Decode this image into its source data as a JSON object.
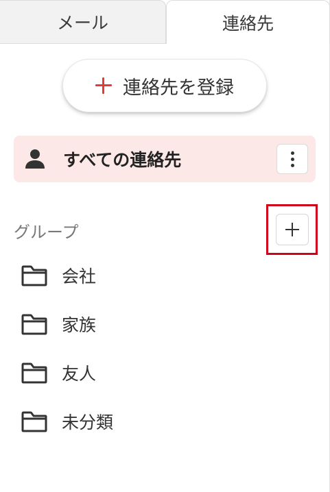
{
  "tabs": {
    "mail": "メール",
    "contacts": "連絡先"
  },
  "register": {
    "label": "連絡先を登録"
  },
  "all_contacts": {
    "label": "すべての連絡先"
  },
  "groups": {
    "title": "グループ",
    "items": [
      {
        "label": "会社"
      },
      {
        "label": "家族"
      },
      {
        "label": "友人"
      },
      {
        "label": "未分類"
      }
    ]
  },
  "colors": {
    "accent_red": "#e53935",
    "selected_bg": "#fde8e8",
    "highlight_border": "#d0021b"
  },
  "icons": {
    "register": "plus-icon",
    "all_contacts": "person-icon",
    "menu": "kebab-menu-icon",
    "add_group": "plus-icon",
    "group": "folder-icon"
  }
}
